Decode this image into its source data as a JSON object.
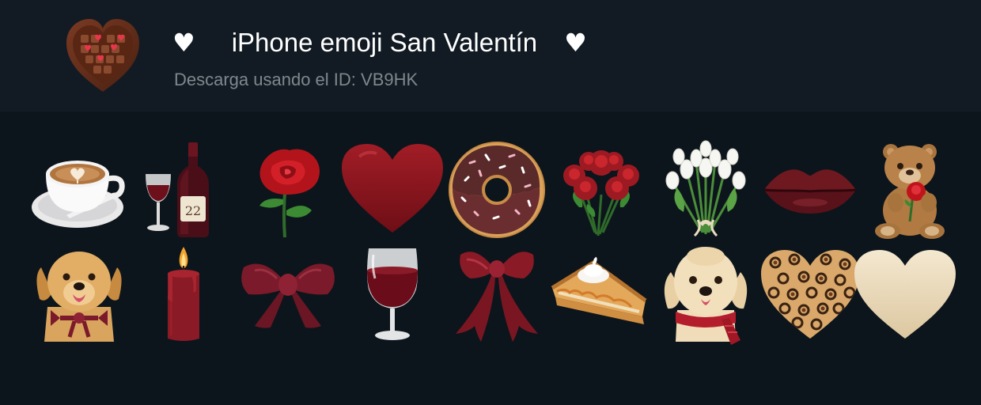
{
  "header": {
    "title": "iPhone emoji San Valentín",
    "heart_left": "♥",
    "heart_right": "♥",
    "subtitle": "Descarga usando el ID: VB9HK",
    "pack_icon": "chocolate-box-heart-icon"
  },
  "emojis": [
    {
      "name": "latte-icon"
    },
    {
      "name": "wine-bottle-glass-icon"
    },
    {
      "name": "red-rose-icon"
    },
    {
      "name": "dark-red-heart-icon"
    },
    {
      "name": "chocolate-donut-icon"
    },
    {
      "name": "rose-bouquet-icon"
    },
    {
      "name": "white-tulips-icon"
    },
    {
      "name": "lips-icon"
    },
    {
      "name": "teddy-bear-rose-icon"
    },
    {
      "name": "golden-retriever-bow-icon"
    },
    {
      "name": "candle-icon"
    },
    {
      "name": "burgundy-bow-icon"
    },
    {
      "name": "red-wine-glass-icon"
    },
    {
      "name": "ribbon-bow-icon"
    },
    {
      "name": "pie-slice-icon"
    },
    {
      "name": "doodle-dog-scarf-icon"
    },
    {
      "name": "leopard-heart-icon"
    },
    {
      "name": "cream-heart-icon"
    }
  ],
  "colors": {
    "background": "#0d151c",
    "header_background": "#121b23",
    "subtitle": "#7f878e",
    "burgundy": "#6e1a24",
    "heart_red": "#8e1622"
  }
}
